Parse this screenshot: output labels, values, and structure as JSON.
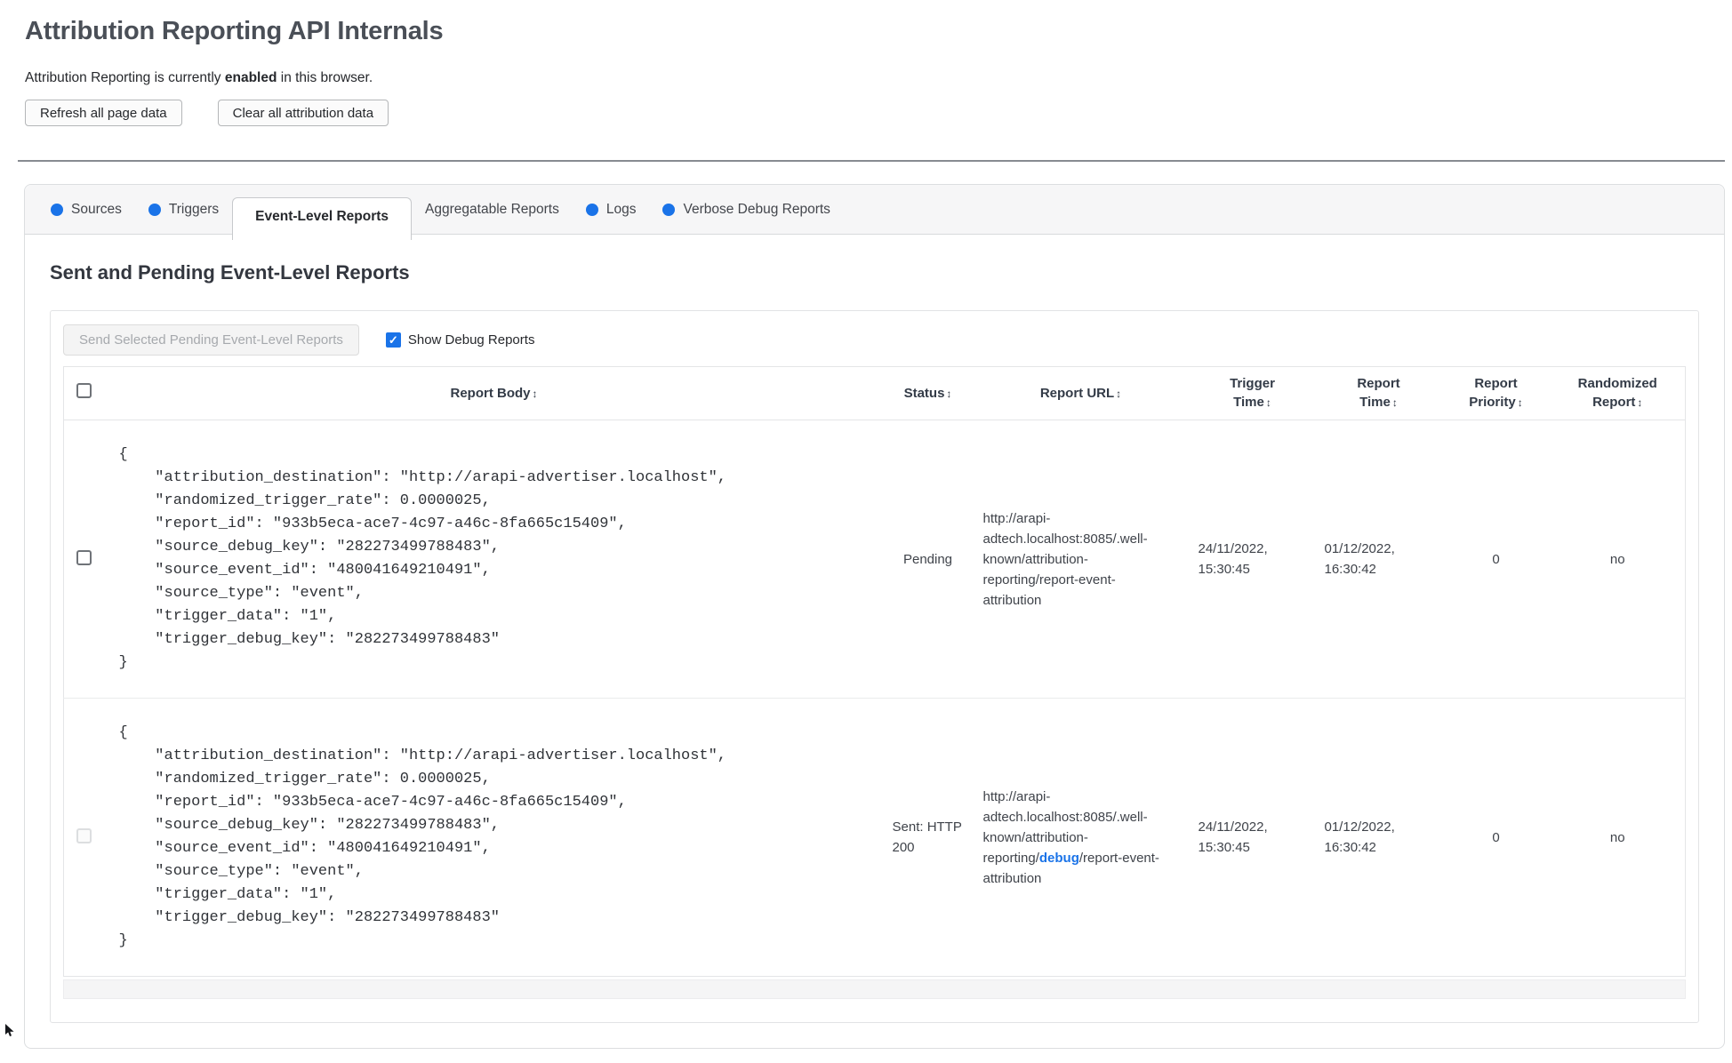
{
  "header": {
    "title": "Attribution Reporting API Internals",
    "status_prefix": "Attribution Reporting is currently",
    "status_emphasis": "enabled",
    "status_suffix": "in this browser.",
    "refresh_button": "Refresh all page data",
    "clear_button": "Clear all attribution data"
  },
  "tabs": [
    {
      "label": "Sources",
      "dot": true,
      "active": false
    },
    {
      "label": "Triggers",
      "dot": true,
      "active": false
    },
    {
      "label": "Event-Level Reports",
      "dot": false,
      "active": true
    },
    {
      "label": "Aggregatable Reports",
      "dot": false,
      "active": false
    },
    {
      "label": "Logs",
      "dot": true,
      "active": false
    },
    {
      "label": "Verbose Debug Reports",
      "dot": true,
      "active": false
    }
  ],
  "section": {
    "heading": "Sent and Pending Event-Level Reports",
    "send_button": "Send Selected Pending Event-Level Reports",
    "send_button_enabled": false,
    "show_debug_label": "Show Debug Reports",
    "show_debug_checked": true
  },
  "table": {
    "sort_icon": "↕",
    "columns": [
      {
        "label": "Report Body"
      },
      {
        "label": "Status"
      },
      {
        "label": "Report URL"
      },
      {
        "label": "Trigger\nTime"
      },
      {
        "label": "Report\nTime"
      },
      {
        "label": "Report\nPriority"
      },
      {
        "label": "Randomized\nReport"
      }
    ],
    "rows": [
      {
        "selectable": true,
        "selected": false,
        "report_body": [
          "{",
          "    \"attribution_destination\": \"http://arapi-advertiser.localhost\",",
          "    \"randomized_trigger_rate\": 0.0000025,",
          "    \"report_id\": \"933b5eca-ace7-4c97-a46c-8fa665c15409\",",
          "    \"source_debug_key\": \"282273499788483\",",
          "    \"source_event_id\": \"480041649210491\",",
          "    \"source_type\": \"event\",",
          "    \"trigger_data\": \"1\",",
          "    \"trigger_debug_key\": \"282273499788483\"",
          "}"
        ],
        "status": "Pending",
        "url": {
          "prefix": "http://arapi-adtech.localhost:8085/.well-known/attribution-reporting/report-event-attribution",
          "link": "",
          "suffix": ""
        },
        "trigger_time": "24/11/2022, 15:30:45",
        "report_time": "01/12/2022, 16:30:42",
        "report_priority": "0",
        "randomized_report": "no"
      },
      {
        "selectable": false,
        "selected": false,
        "report_body": [
          "{",
          "    \"attribution_destination\": \"http://arapi-advertiser.localhost\",",
          "    \"randomized_trigger_rate\": 0.0000025,",
          "    \"report_id\": \"933b5eca-ace7-4c97-a46c-8fa665c15409\",",
          "    \"source_debug_key\": \"282273499788483\",",
          "    \"source_event_id\": \"480041649210491\",",
          "    \"source_type\": \"event\",",
          "    \"trigger_data\": \"1\",",
          "    \"trigger_debug_key\": \"282273499788483\"",
          "}"
        ],
        "status": "Sent: HTTP 200",
        "url": {
          "prefix": "http://arapi-adtech.localhost:8085/.well-known/attribution-reporting/",
          "link": "debug",
          "suffix": "/report-event-attribution"
        },
        "trigger_time": "24/11/2022, 15:30:45",
        "report_time": "01/12/2022, 16:30:42",
        "report_priority": "0",
        "randomized_report": "no"
      }
    ]
  },
  "colors": {
    "accent_blue": "#1a73e8"
  }
}
